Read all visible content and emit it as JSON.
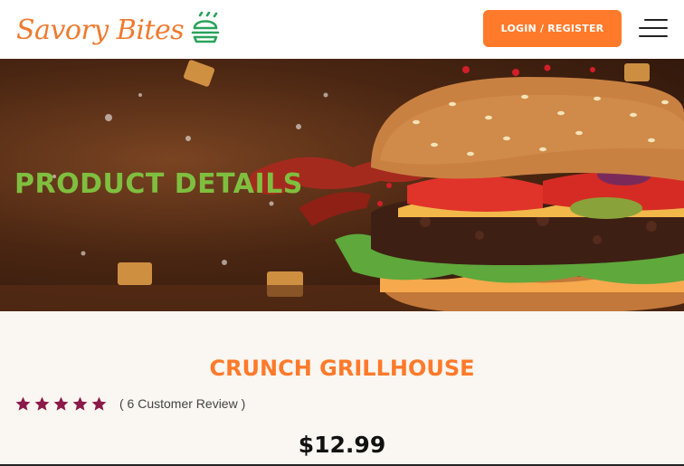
{
  "header": {
    "brand": "Savory Bites",
    "brand_color": "#ef7a2f",
    "icon_color": "#2aa35a",
    "login_label": "LOGIN / REGISTER",
    "accent": "#ff7a2a"
  },
  "hero": {
    "title": "PRODUCT DETAILS",
    "title_color": "#7fbf3f"
  },
  "product": {
    "name": "CRUNCH GRILLHOUSE",
    "rating_stars": 5,
    "star_color": "#8b1a4a",
    "review_text": "( 6 Customer Review )",
    "price": "$12.99"
  }
}
